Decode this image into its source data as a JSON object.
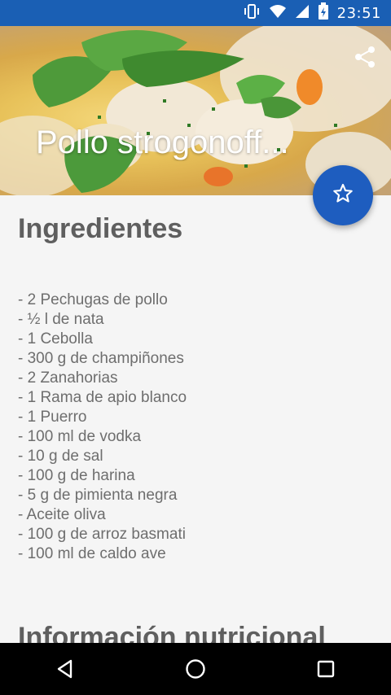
{
  "status_bar": {
    "time": "23:51",
    "icons": [
      "vibrate-icon",
      "wifi-icon",
      "signal-icon",
      "battery-icon"
    ]
  },
  "recipe": {
    "title": "Pollo strogonoff..."
  },
  "ingredients_section": {
    "title": "Ingredientes",
    "items": [
      "- 2 Pechugas de pollo",
      "- ½ l de nata",
      "- 1 Cebolla",
      "- 300 g de champiñones",
      "- 2 Zanahorias",
      "- 1 Rama de apio blanco",
      "- 1 Puerro",
      "- 100 ml de vodka",
      "- 10 g de sal",
      "- 100 g de harina",
      "- 5 g de pimienta negra",
      "- Aceite oliva",
      "- 100 g de arroz basmati",
      "- 100 ml de caldo ave"
    ]
  },
  "nutrition_section": {
    "title": "Información nutricional"
  },
  "colors": {
    "status_bar": "#1a5fb4",
    "fab": "#1e5dbf",
    "text": "#6e6e6e"
  }
}
